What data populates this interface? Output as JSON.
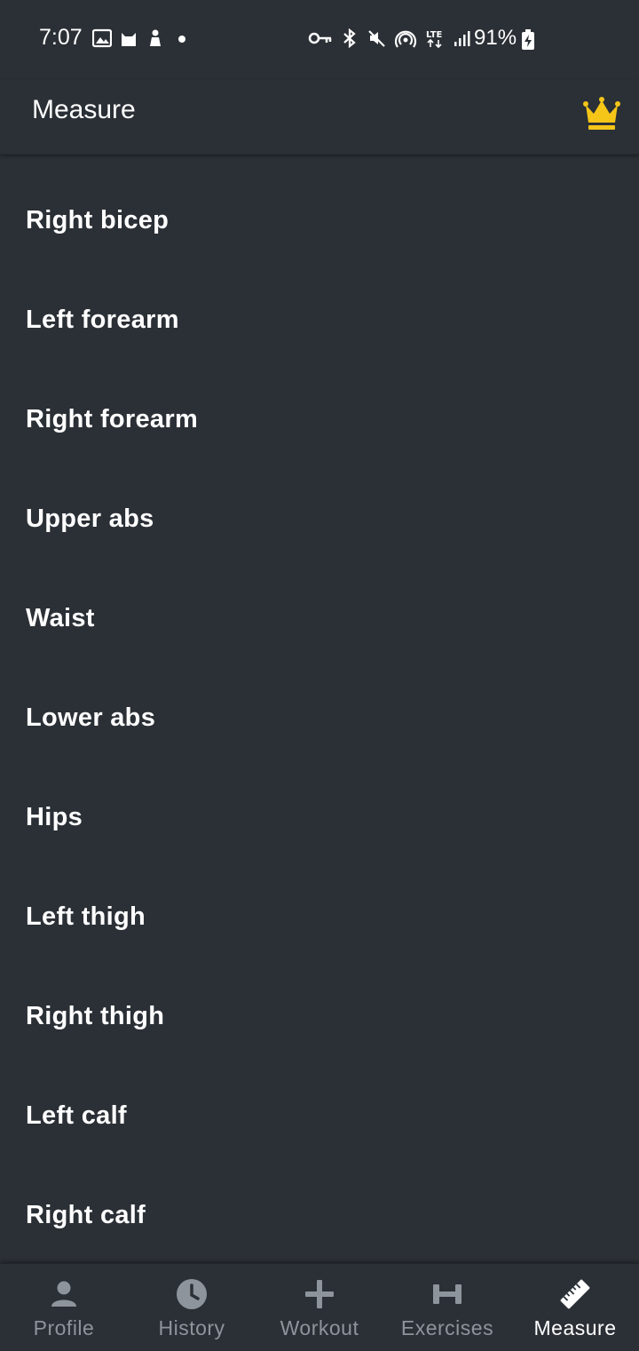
{
  "status_bar": {
    "time": "7:07",
    "battery": "91%",
    "left_icons": [
      "image-icon",
      "cat-icon",
      "person-icon",
      "dot-icon"
    ],
    "right_icons": [
      "vpn-key-icon",
      "bluetooth-icon",
      "mute-icon",
      "hotspot-icon",
      "lte-icon",
      "signal-icon"
    ]
  },
  "app_bar": {
    "title": "Measure",
    "crown_color": "#f5c518"
  },
  "measurements": [
    "Right bicep",
    "Left forearm",
    "Right forearm",
    "Upper abs",
    "Waist",
    "Lower abs",
    "Hips",
    "Left thigh",
    "Right thigh",
    "Left calf",
    "Right calf"
  ],
  "bottom_nav": {
    "items": [
      {
        "label": "Profile",
        "icon": "person-icon",
        "active": false
      },
      {
        "label": "History",
        "icon": "clock-icon",
        "active": false
      },
      {
        "label": "Workout",
        "icon": "plus-icon",
        "active": false
      },
      {
        "label": "Exercises",
        "icon": "dumbbell-icon",
        "active": false
      },
      {
        "label": "Measure",
        "icon": "ruler-icon",
        "active": true
      }
    ]
  }
}
